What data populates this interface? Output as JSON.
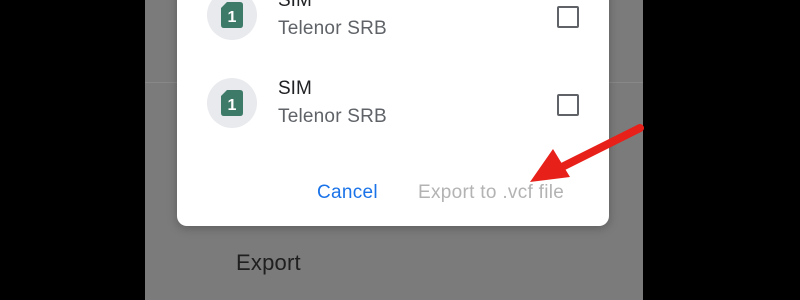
{
  "background": {
    "export_label": "Export"
  },
  "dialog": {
    "sims": [
      {
        "title": "SIM",
        "carrier": "Telenor SRB",
        "slot": "1",
        "checked": false
      },
      {
        "title": "SIM",
        "carrier": "Telenor SRB",
        "slot": "1",
        "checked": false
      }
    ],
    "cancel_label": "Cancel",
    "export_label": "Export to .vcf file"
  },
  "colors": {
    "accent": "#1a73e8",
    "sim_icon": "#3d7a67",
    "annotation_arrow": "#e8201a",
    "disabled_text": "#b3b3b3"
  },
  "icons": {
    "sim": "sim-card-icon",
    "checkbox": "checkbox-unchecked-icon",
    "arrow": "red-arrow-annotation-icon"
  }
}
